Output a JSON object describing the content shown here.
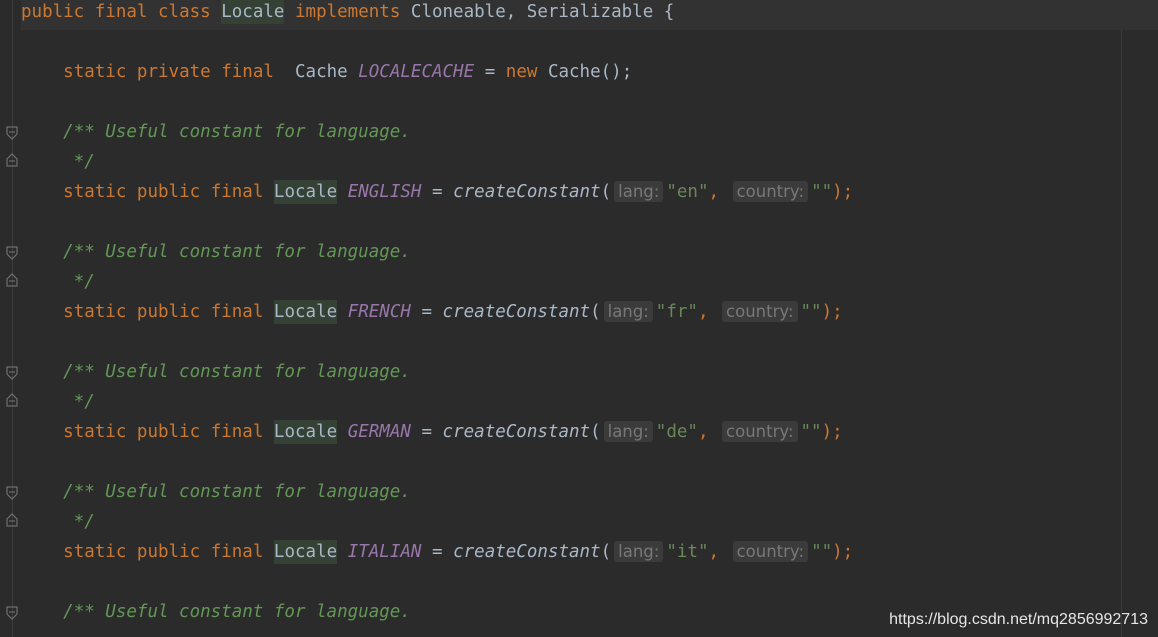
{
  "line1": {
    "kw1": "public",
    "kw2": "final",
    "kw3": "class",
    "cls": "Locale",
    "kw4": "implements",
    "rest": "Cloneable, Serializable {"
  },
  "cache_line": {
    "kw1": "static",
    "kw2": "private",
    "kw3": "final",
    "type": "Cache",
    "const": "LOCALECACHE",
    "eq": "=",
    "kw_new": "new",
    "rest": "Cache();"
  },
  "doc_open": "/** Useful constant for language.",
  "doc_close": " */",
  "constants": [
    {
      "name": "ENGLISH",
      "lang": "\"en\"",
      "country": "\"\""
    },
    {
      "name": "FRENCH",
      "lang": "\"fr\"",
      "country": "\"\""
    },
    {
      "name": "GERMAN",
      "lang": "\"de\"",
      "country": "\"\""
    },
    {
      "name": "ITALIAN",
      "lang": "\"it\"",
      "country": "\"\""
    }
  ],
  "decl": {
    "kw1": "static",
    "kw2": "public",
    "kw3": "final",
    "type": "Locale",
    "eq": "=",
    "method": "createConstant",
    "open": "(",
    "hint_lang": "lang:",
    "hint_country": "country:",
    "comma": ",",
    "close": ");"
  },
  "watermark": "https://blog.csdn.net/mq2856992713",
  "colors": {
    "background": "#2b2b2b",
    "keyword": "#cc7832",
    "constant": "#9876aa",
    "string": "#6a8759",
    "doc_comment": "#629755",
    "identifier_highlight": "#344134"
  }
}
